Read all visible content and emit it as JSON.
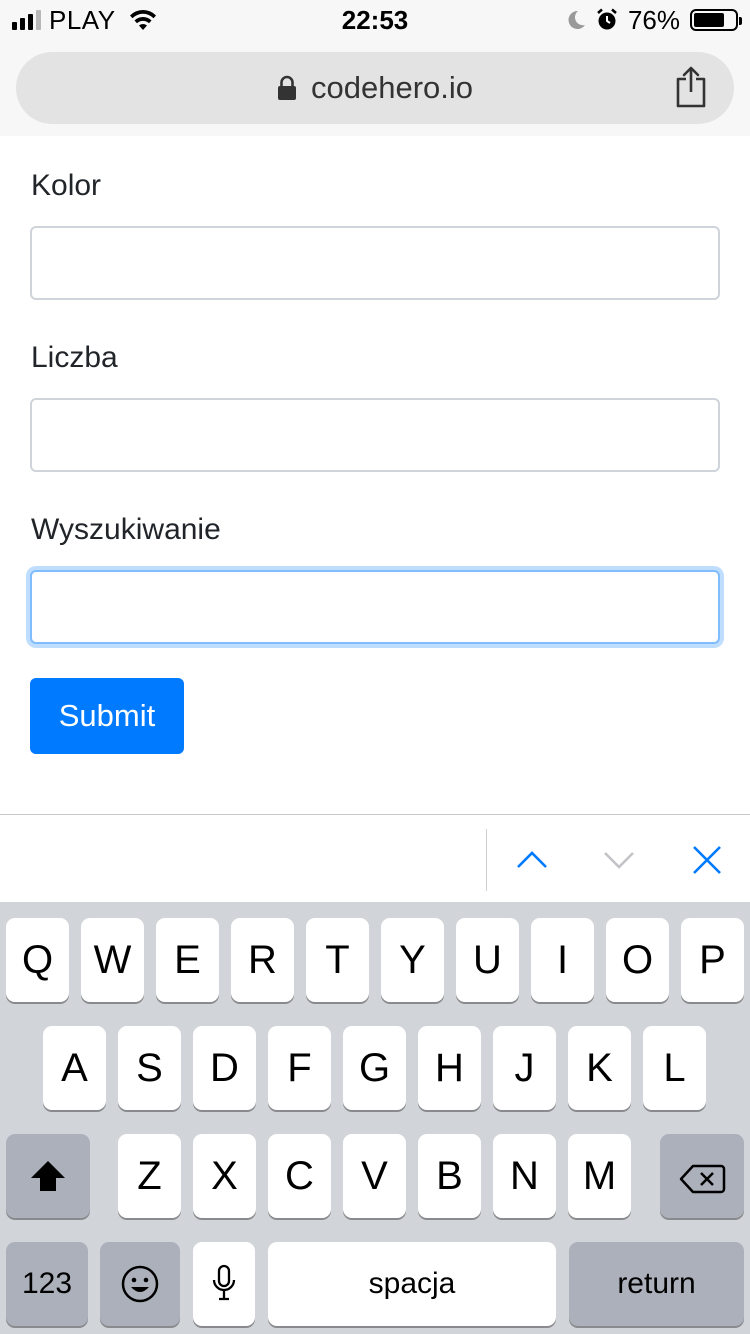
{
  "status_bar": {
    "carrier": "PLAY",
    "time": "22:53",
    "battery_percent": "76%",
    "battery_level": 0.76,
    "signal_bars_filled": 3,
    "signal_bars_total": 4
  },
  "browser": {
    "url": "codehero.io"
  },
  "form": {
    "fields": [
      {
        "label": "Kolor",
        "value": "",
        "focused": false
      },
      {
        "label": "Liczba",
        "value": "",
        "focused": false
      },
      {
        "label": "Wyszukiwanie",
        "value": "",
        "focused": true
      }
    ],
    "submit_label": "Submit"
  },
  "accessory_bar": {
    "icons": [
      "chevron-up-icon",
      "chevron-down-icon",
      "close-icon"
    ]
  },
  "keyboard": {
    "row1": [
      "Q",
      "W",
      "E",
      "R",
      "T",
      "Y",
      "U",
      "I",
      "O",
      "P"
    ],
    "row2": [
      "A",
      "S",
      "D",
      "F",
      "G",
      "H",
      "J",
      "K",
      "L"
    ],
    "row3": [
      "Z",
      "X",
      "C",
      "V",
      "B",
      "N",
      "M"
    ],
    "numbers_label": "123",
    "space_label": "spacja",
    "return_label": "return"
  },
  "colors": {
    "accent": "#007bff",
    "focus_border": "#80bdff",
    "keyboard_bg": "#d1d4d9",
    "dark_key": "#abb0ba"
  }
}
